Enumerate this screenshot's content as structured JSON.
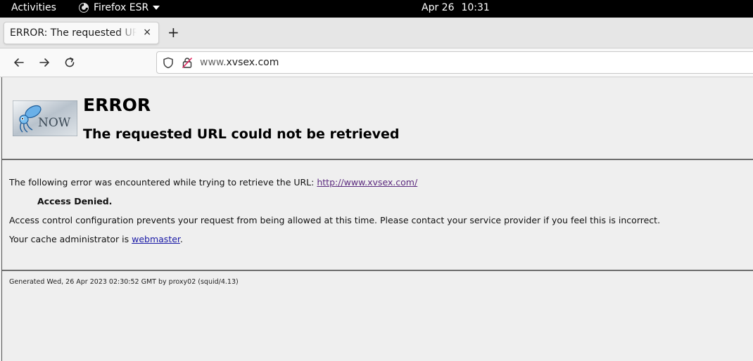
{
  "topbar": {
    "activities": "Activities",
    "app_name": "Firefox ESR",
    "date": "Apr 26",
    "time": "10:31"
  },
  "tab": {
    "title": "ERROR: The requested URL could not be retrieved",
    "close": "×"
  },
  "newtab": "+",
  "urlbar": {
    "url_prefix": "www.",
    "url_domain": "xvsex.com"
  },
  "page": {
    "logo_text": "NOW",
    "title": "ERROR",
    "subtitle": "The requested URL could not be retrieved",
    "line1_text": "The following error was encountered while trying to retrieve the URL: ",
    "line1_link": "http://www.xvsex.com/",
    "access_denied": "Access Denied.",
    "explanation": "Access control configuration prevents your request from being allowed at this time. Please contact your service provider if you feel this is incorrect.",
    "admin_text": "Your cache administrator is ",
    "admin_link": "webmaster",
    "admin_suffix": ".",
    "footer": "Generated Wed, 26 Apr 2023 02:30:52 GMT by proxy02 (squid/4.13)"
  },
  "colors": {
    "visited_link": "#5b2a7e",
    "link": "#1a1aa6",
    "background": "#efefef"
  }
}
